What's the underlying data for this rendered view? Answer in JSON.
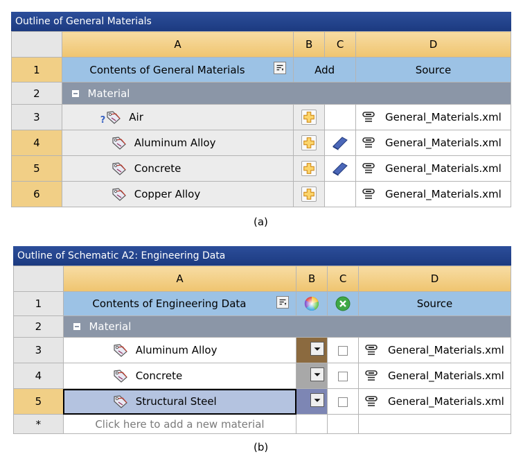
{
  "panel_a": {
    "title": "Outline of General Materials",
    "columns": [
      "A",
      "B",
      "C",
      "D"
    ],
    "header_row": {
      "num": "1",
      "contents": "Contents of General Materials",
      "add": "Add",
      "source": "Source"
    },
    "group_row": {
      "num": "2",
      "label": "Material",
      "expander": "−"
    },
    "rows": [
      {
        "num": "3",
        "name": "Air",
        "qmark": "?",
        "source": "General_Materials.xml"
      },
      {
        "num": "4",
        "name": "Aluminum Alloy",
        "source": "General_Materials.xml"
      },
      {
        "num": "5",
        "name": "Concrete",
        "source": "General_Materials.xml"
      },
      {
        "num": "6",
        "name": "Copper Alloy",
        "source": "General_Materials.xml"
      }
    ],
    "caption": "(a)"
  },
  "panel_b": {
    "title": "Outline of Schematic A2: Engineering Data",
    "columns": [
      "A",
      "B",
      "C",
      "D"
    ],
    "header_row": {
      "num": "1",
      "contents": "Contents of Engineering Data",
      "source": "Source"
    },
    "group_row": {
      "num": "2",
      "label": "Material",
      "expander": "−"
    },
    "rows": [
      {
        "num": "3",
        "name": "Aluminum Alloy",
        "source": "General_Materials.xml"
      },
      {
        "num": "4",
        "name": "Concrete",
        "source": "General_Materials.xml"
      },
      {
        "num": "5",
        "name": "Structural Steel",
        "source": "General_Materials.xml"
      }
    ],
    "new_row": {
      "num": "*",
      "placeholder": "Click here to add a new material"
    },
    "caption": "(b)"
  },
  "icons": {
    "tag": "material-tag-icon",
    "sort": "sort-icon",
    "add": "add-plus-icon",
    "book": "library-book-icon",
    "link": "link-icon",
    "color": "color-wheel-icon",
    "suppress": "suppress-x-icon",
    "dropdown": "dropdown-arrow-icon",
    "checkbox": "checkbox-icon"
  },
  "colors": {
    "title_bar": "#1f3d86",
    "column_header": "#f0c87a",
    "contents_row": "#9cc2e5",
    "group_row": "#8b96a7",
    "selected_row": "#b4c3e0"
  }
}
